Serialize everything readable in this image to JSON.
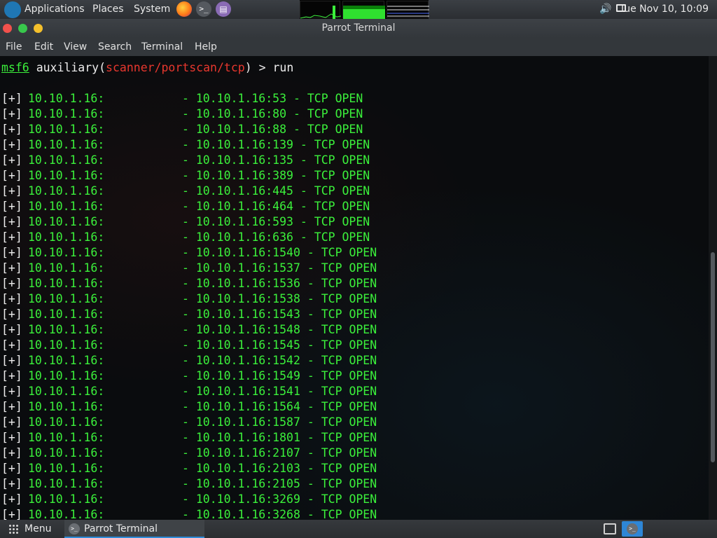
{
  "top_panel": {
    "menus": [
      "Applications",
      "Places",
      "System"
    ],
    "clock": "Tue Nov 10, 10:09"
  },
  "window": {
    "title": "Parrot Terminal",
    "menu": [
      "File",
      "Edit",
      "View",
      "Search",
      "Terminal",
      "Help"
    ]
  },
  "terminal": {
    "prompt": {
      "shell": "msf6",
      "module_type": "auxiliary",
      "module_path": "scanner/portscan/tcp",
      "command": "> run"
    },
    "result_prefix": "[+]",
    "host_label": "10.10.1.16:",
    "status": "TCP OPEN",
    "results": [
      "10.10.1.16:53",
      "10.10.1.16:80",
      "10.10.1.16:88",
      "10.10.1.16:139",
      "10.10.1.16:135",
      "10.10.1.16:389",
      "10.10.1.16:445",
      "10.10.1.16:464",
      "10.10.1.16:593",
      "10.10.1.16:636",
      "10.10.1.16:1540",
      "10.10.1.16:1537",
      "10.10.1.16:1536",
      "10.10.1.16:1538",
      "10.10.1.16:1543",
      "10.10.1.16:1548",
      "10.10.1.16:1545",
      "10.10.1.16:1542",
      "10.10.1.16:1549",
      "10.10.1.16:1541",
      "10.10.1.16:1564",
      "10.10.1.16:1587",
      "10.10.1.16:1801",
      "10.10.1.16:2107",
      "10.10.1.16:2103",
      "10.10.1.16:2105",
      "10.10.1.16:3269",
      "10.10.1.16:3268"
    ]
  },
  "bottom_panel": {
    "menu_label": "Menu",
    "task_label": "Parrot Terminal"
  },
  "colors": {
    "prompt_green": "#3bf03b",
    "module_red": "#e8372e",
    "text_white": "#ededed",
    "close": "#f2514c",
    "minimize": "#38c84c",
    "maximize": "#f4c02c",
    "accent_blue": "#2e86d6"
  }
}
